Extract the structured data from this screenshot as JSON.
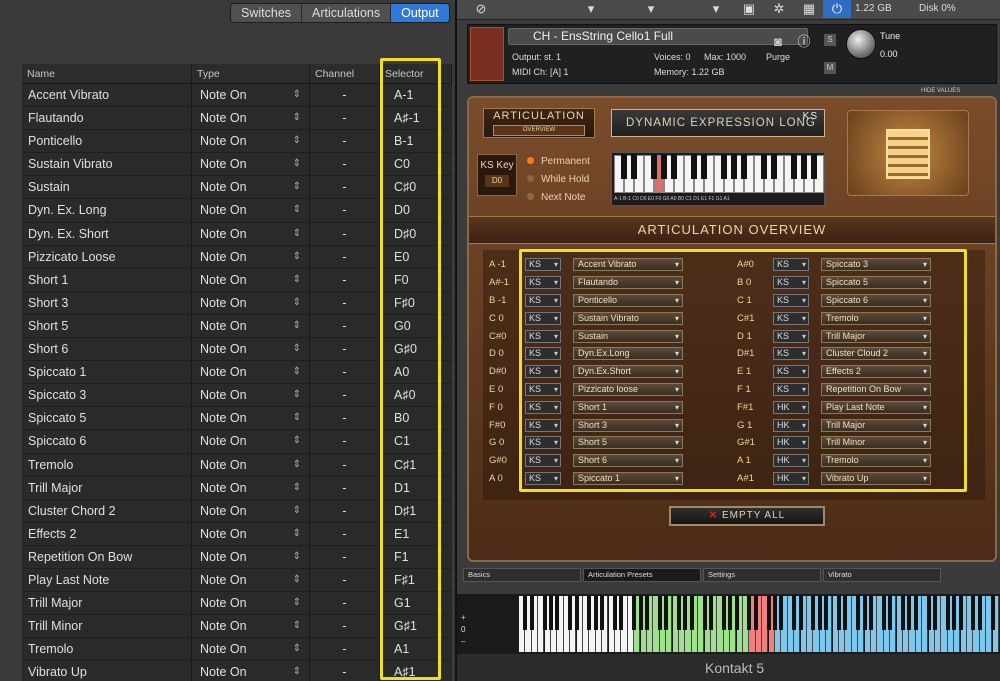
{
  "left_panel": {
    "tabs": [
      {
        "label": "Switches",
        "active": false
      },
      {
        "label": "Articulations",
        "active": false
      },
      {
        "label": "Output",
        "active": true
      }
    ],
    "columns": [
      "Name",
      "Type",
      "Channel",
      "Selector"
    ],
    "rows": [
      {
        "name": "Accent Vibrato",
        "type": "Note On",
        "channel": "-",
        "selector": "A-1"
      },
      {
        "name": "Flautando",
        "type": "Note On",
        "channel": "-",
        "selector": "A♯-1"
      },
      {
        "name": "Ponticello",
        "type": "Note On",
        "channel": "-",
        "selector": "B-1"
      },
      {
        "name": "Sustain Vibrato",
        "type": "Note On",
        "channel": "-",
        "selector": "C0"
      },
      {
        "name": "Sustain",
        "type": "Note On",
        "channel": "-",
        "selector": "C♯0"
      },
      {
        "name": "Dyn. Ex. Long",
        "type": "Note On",
        "channel": "-",
        "selector": "D0"
      },
      {
        "name": "Dyn. Ex. Short",
        "type": "Note On",
        "channel": "-",
        "selector": "D♯0"
      },
      {
        "name": "Pizzicato Loose",
        "type": "Note On",
        "channel": "-",
        "selector": "E0"
      },
      {
        "name": "Short 1",
        "type": "Note On",
        "channel": "-",
        "selector": "F0"
      },
      {
        "name": "Short 3",
        "type": "Note On",
        "channel": "-",
        "selector": "F♯0"
      },
      {
        "name": "Short 5",
        "type": "Note On",
        "channel": "-",
        "selector": "G0"
      },
      {
        "name": "Short 6",
        "type": "Note On",
        "channel": "-",
        "selector": "G♯0"
      },
      {
        "name": "Spiccato 1",
        "type": "Note On",
        "channel": "-",
        "selector": "A0"
      },
      {
        "name": "Spiccato 3",
        "type": "Note On",
        "channel": "-",
        "selector": "A♯0"
      },
      {
        "name": "Spiccato 5",
        "type": "Note On",
        "channel": "-",
        "selector": "B0"
      },
      {
        "name": "Spiccato 6",
        "type": "Note On",
        "channel": "-",
        "selector": "C1"
      },
      {
        "name": "Tremolo",
        "type": "Note On",
        "channel": "-",
        "selector": "C♯1"
      },
      {
        "name": "Trill Major",
        "type": "Note On",
        "channel": "-",
        "selector": "D1"
      },
      {
        "name": "Cluster Chord 2",
        "type": "Note On",
        "channel": "-",
        "selector": "D♯1"
      },
      {
        "name": "Effects 2",
        "type": "Note On",
        "channel": "-",
        "selector": "E1"
      },
      {
        "name": "Repetition On Bow",
        "type": "Note On",
        "channel": "-",
        "selector": "F1"
      },
      {
        "name": "Play Last Note",
        "type": "Note On",
        "channel": "-",
        "selector": "F♯1"
      },
      {
        "name": "Trill Major",
        "type": "Note On",
        "channel": "-",
        "selector": "G1"
      },
      {
        "name": "Trill Minor",
        "type": "Note On",
        "channel": "-",
        "selector": "G♯1"
      },
      {
        "name": "Tremolo",
        "type": "Note On",
        "channel": "-",
        "selector": "A1"
      },
      {
        "name": "Vibrato Up",
        "type": "Note On",
        "channel": "-",
        "selector": "A♯1"
      }
    ]
  },
  "kontakt": {
    "memory_top": "1.22 GB",
    "disk_top": "Disk 0%",
    "instrument_name": "CH - EnsString Cello1 Full",
    "output": "Output: st. 1",
    "voices": "Voices: 0",
    "max": "Max: 1000",
    "purge": "Purge",
    "midi": "MIDI Ch: [A] 1",
    "memory": "Memory: 1.22 GB",
    "tune_label": "Tune",
    "tune_value": "0.00",
    "s_label": "S",
    "m_label": "M",
    "hide_values": "HIDE VALUES",
    "footer": "Kontakt 5"
  },
  "articulation": {
    "label": "ARTICULATION",
    "overview_btn": "OVERVIEW",
    "current": "DYNAMIC EXPRESSION LONG",
    "current_ks": "KS",
    "ks_key_label": "KS Key",
    "ks_key_value": "D0",
    "modes": [
      {
        "label": "Permanent",
        "active": true
      },
      {
        "label": "While Hold",
        "active": false
      },
      {
        "label": "Next Note",
        "active": false
      }
    ],
    "mini_keyboard_labels": "A-1 B-1 C0 D0 E0 F0 G0 A0 B0 C1 D1 E1 F1 G1 A1",
    "overview_title": "ARTICULATION OVERVIEW",
    "empty_btn_x": "✕",
    "empty_btn": "EMPTY ALL",
    "left_col": [
      {
        "note": "A -1",
        "mode": "KS",
        "art": "Accent Vibrato"
      },
      {
        "note": "A#-1",
        "mode": "KS",
        "art": "Flautando"
      },
      {
        "note": "B -1",
        "mode": "KS",
        "art": "Ponticello"
      },
      {
        "note": "C 0",
        "mode": "KS",
        "art": "Sustain Vibrato"
      },
      {
        "note": "C#0",
        "mode": "KS",
        "art": "Sustain"
      },
      {
        "note": "D 0",
        "mode": "KS",
        "art": "Dyn.Ex.Long"
      },
      {
        "note": "D#0",
        "mode": "KS",
        "art": "Dyn.Ex.Short"
      },
      {
        "note": "E 0",
        "mode": "KS",
        "art": "Pizzicato loose"
      },
      {
        "note": "F 0",
        "mode": "KS",
        "art": "Short 1"
      },
      {
        "note": "F#0",
        "mode": "KS",
        "art": "Short 3"
      },
      {
        "note": "G 0",
        "mode": "KS",
        "art": "Short 5"
      },
      {
        "note": "G#0",
        "mode": "KS",
        "art": "Short 6"
      },
      {
        "note": "A 0",
        "mode": "KS",
        "art": "Spiccato 1"
      }
    ],
    "right_col": [
      {
        "note": "A#0",
        "mode": "KS",
        "art": "Spiccato 3"
      },
      {
        "note": "B 0",
        "mode": "KS",
        "art": "Spiccato 5"
      },
      {
        "note": "C 1",
        "mode": "KS",
        "art": "Spiccato 6"
      },
      {
        "note": "C#1",
        "mode": "KS",
        "art": "Tremolo"
      },
      {
        "note": "D 1",
        "mode": "KS",
        "art": "Trill Major"
      },
      {
        "note": "D#1",
        "mode": "KS",
        "art": "Cluster Cloud 2"
      },
      {
        "note": "E 1",
        "mode": "KS",
        "art": "Effects 2"
      },
      {
        "note": "F 1",
        "mode": "KS",
        "art": "Repetition On Bow"
      },
      {
        "note": "F#1",
        "mode": "HK",
        "art": "Play Last Note"
      },
      {
        "note": "G 1",
        "mode": "HK",
        "art": "Trill Major"
      },
      {
        "note": "G#1",
        "mode": "HK",
        "art": "Trill Minor"
      },
      {
        "note": "A 1",
        "mode": "HK",
        "art": "Tremolo"
      },
      {
        "note": "A#1",
        "mode": "HK",
        "art": "Vibrato Up"
      }
    ]
  },
  "bottom_tabs": [
    {
      "label": "Basics",
      "active": false
    },
    {
      "label": "Articulation Presets",
      "active": true
    },
    {
      "label": "Settings",
      "active": false
    },
    {
      "label": "Vibrato",
      "active": false
    }
  ],
  "keyboard": {
    "octave_up": "+",
    "octave_value": "0",
    "octave_down": "–"
  }
}
